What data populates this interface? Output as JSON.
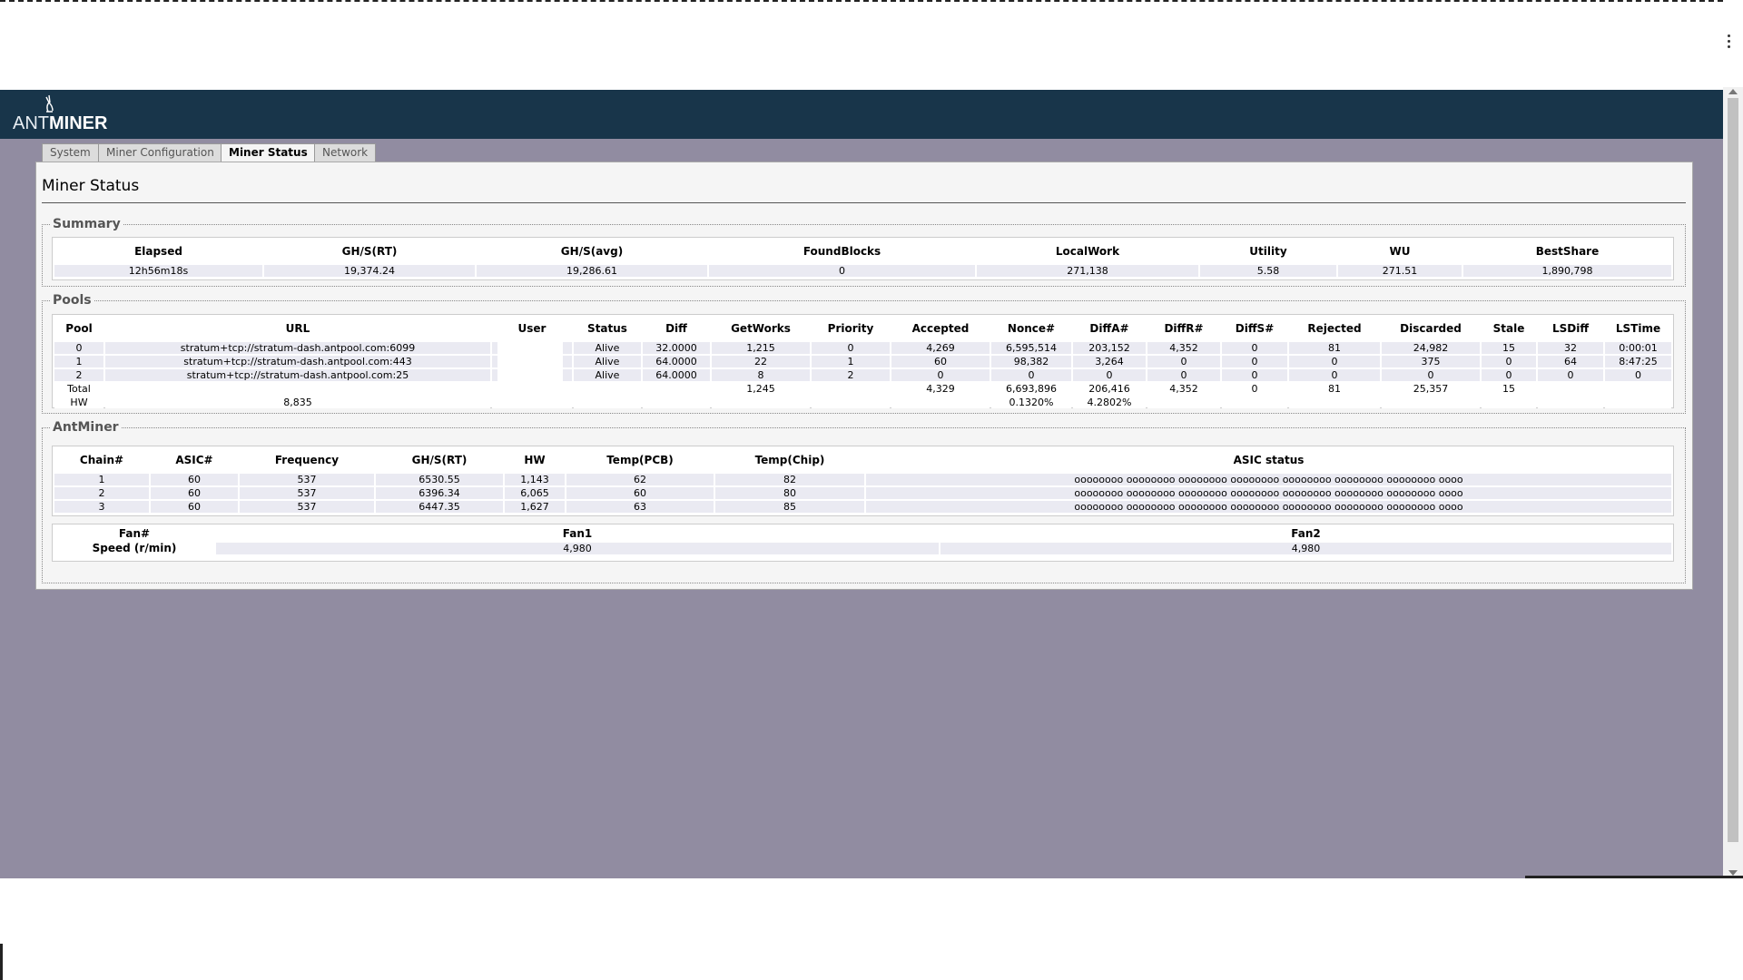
{
  "app": {
    "logo_ant": "ANT",
    "logo_miner": "MINER"
  },
  "tabs": [
    {
      "label": "System"
    },
    {
      "label": "Miner Configuration"
    },
    {
      "label": "Miner Status"
    },
    {
      "label": "Network"
    }
  ],
  "page_title": "Miner Status",
  "summary": {
    "legend": "Summary",
    "headers": [
      "Elapsed",
      "GH/S(RT)",
      "GH/S(avg)",
      "FoundBlocks",
      "LocalWork",
      "Utility",
      "WU",
      "BestShare"
    ],
    "values": [
      "12h56m18s",
      "19,374.24",
      "19,286.61",
      "0",
      "271,138",
      "5.58",
      "271.51",
      "1,890,798"
    ]
  },
  "pools": {
    "legend": "Pools",
    "headers": [
      "Pool",
      "URL",
      "User",
      "Status",
      "Diff",
      "GetWorks",
      "Priority",
      "Accepted",
      "Nonce#",
      "DiffA#",
      "DiffR#",
      "DiffS#",
      "Rejected",
      "Discarded",
      "Stale",
      "LSDiff",
      "LSTime"
    ],
    "rows": [
      [
        "0",
        "stratum+tcp://stratum-dash.antpool.com:6099",
        "",
        "Alive",
        "32.0000",
        "1,215",
        "0",
        "4,269",
        "6,595,514",
        "203,152",
        "4,352",
        "0",
        "81",
        "24,982",
        "15",
        "32",
        "0:00:01"
      ],
      [
        "1",
        "stratum+tcp://stratum-dash.antpool.com:443",
        "",
        "Alive",
        "64.0000",
        "22",
        "1",
        "60",
        "98,382",
        "3,264",
        "0",
        "0",
        "0",
        "375",
        "0",
        "64",
        "8:47:25"
      ],
      [
        "2",
        "stratum+tcp://stratum-dash.antpool.com:25",
        "",
        "Alive",
        "64.0000",
        "8",
        "2",
        "0",
        "0",
        "0",
        "0",
        "0",
        "0",
        "0",
        "0",
        "0",
        "0"
      ],
      [
        "Total",
        "",
        "",
        "",
        "",
        "1,245",
        "",
        "4,329",
        "6,693,896",
        "206,416",
        "4,352",
        "0",
        "81",
        "25,357",
        "15",
        "",
        ""
      ],
      [
        "HW",
        "8,835",
        "",
        "",
        "",
        "",
        "",
        "",
        "0.1320%",
        "4.2802%",
        "",
        "",
        "",
        "",
        "",
        "",
        ""
      ]
    ]
  },
  "antminer": {
    "legend": "AntMiner",
    "headers": [
      "Chain#",
      "ASIC#",
      "Frequency",
      "GH/S(RT)",
      "HW",
      "Temp(PCB)",
      "Temp(Chip)",
      "ASIC status"
    ],
    "rows": [
      [
        "1",
        "60",
        "537",
        "6530.55",
        "1,143",
        "62",
        "82",
        "oooooooo oooooooo oooooooo oooooooo oooooooo oooooooo oooooooo oooo"
      ],
      [
        "2",
        "60",
        "537",
        "6396.34",
        "6,065",
        "60",
        "80",
        "oooooooo oooooooo oooooooo oooooooo oooooooo oooooooo oooooooo oooo"
      ],
      [
        "3",
        "60",
        "537",
        "6447.35",
        "1,627",
        "63",
        "85",
        "oooooooo oooooooo oooooooo oooooooo oooooooo oooooooo oooooooo oooo"
      ]
    ]
  },
  "fans": {
    "headers": [
      "Fan#",
      "Fan1",
      "Fan2"
    ],
    "row_label": "Speed (r/min)",
    "values": [
      "4,980",
      "4,980"
    ]
  },
  "colors": {
    "header_bg": "#18354a",
    "page_bg": "#918ca1",
    "panel_bg": "#f5f5f5",
    "row_bg": "#eaeaf2"
  }
}
